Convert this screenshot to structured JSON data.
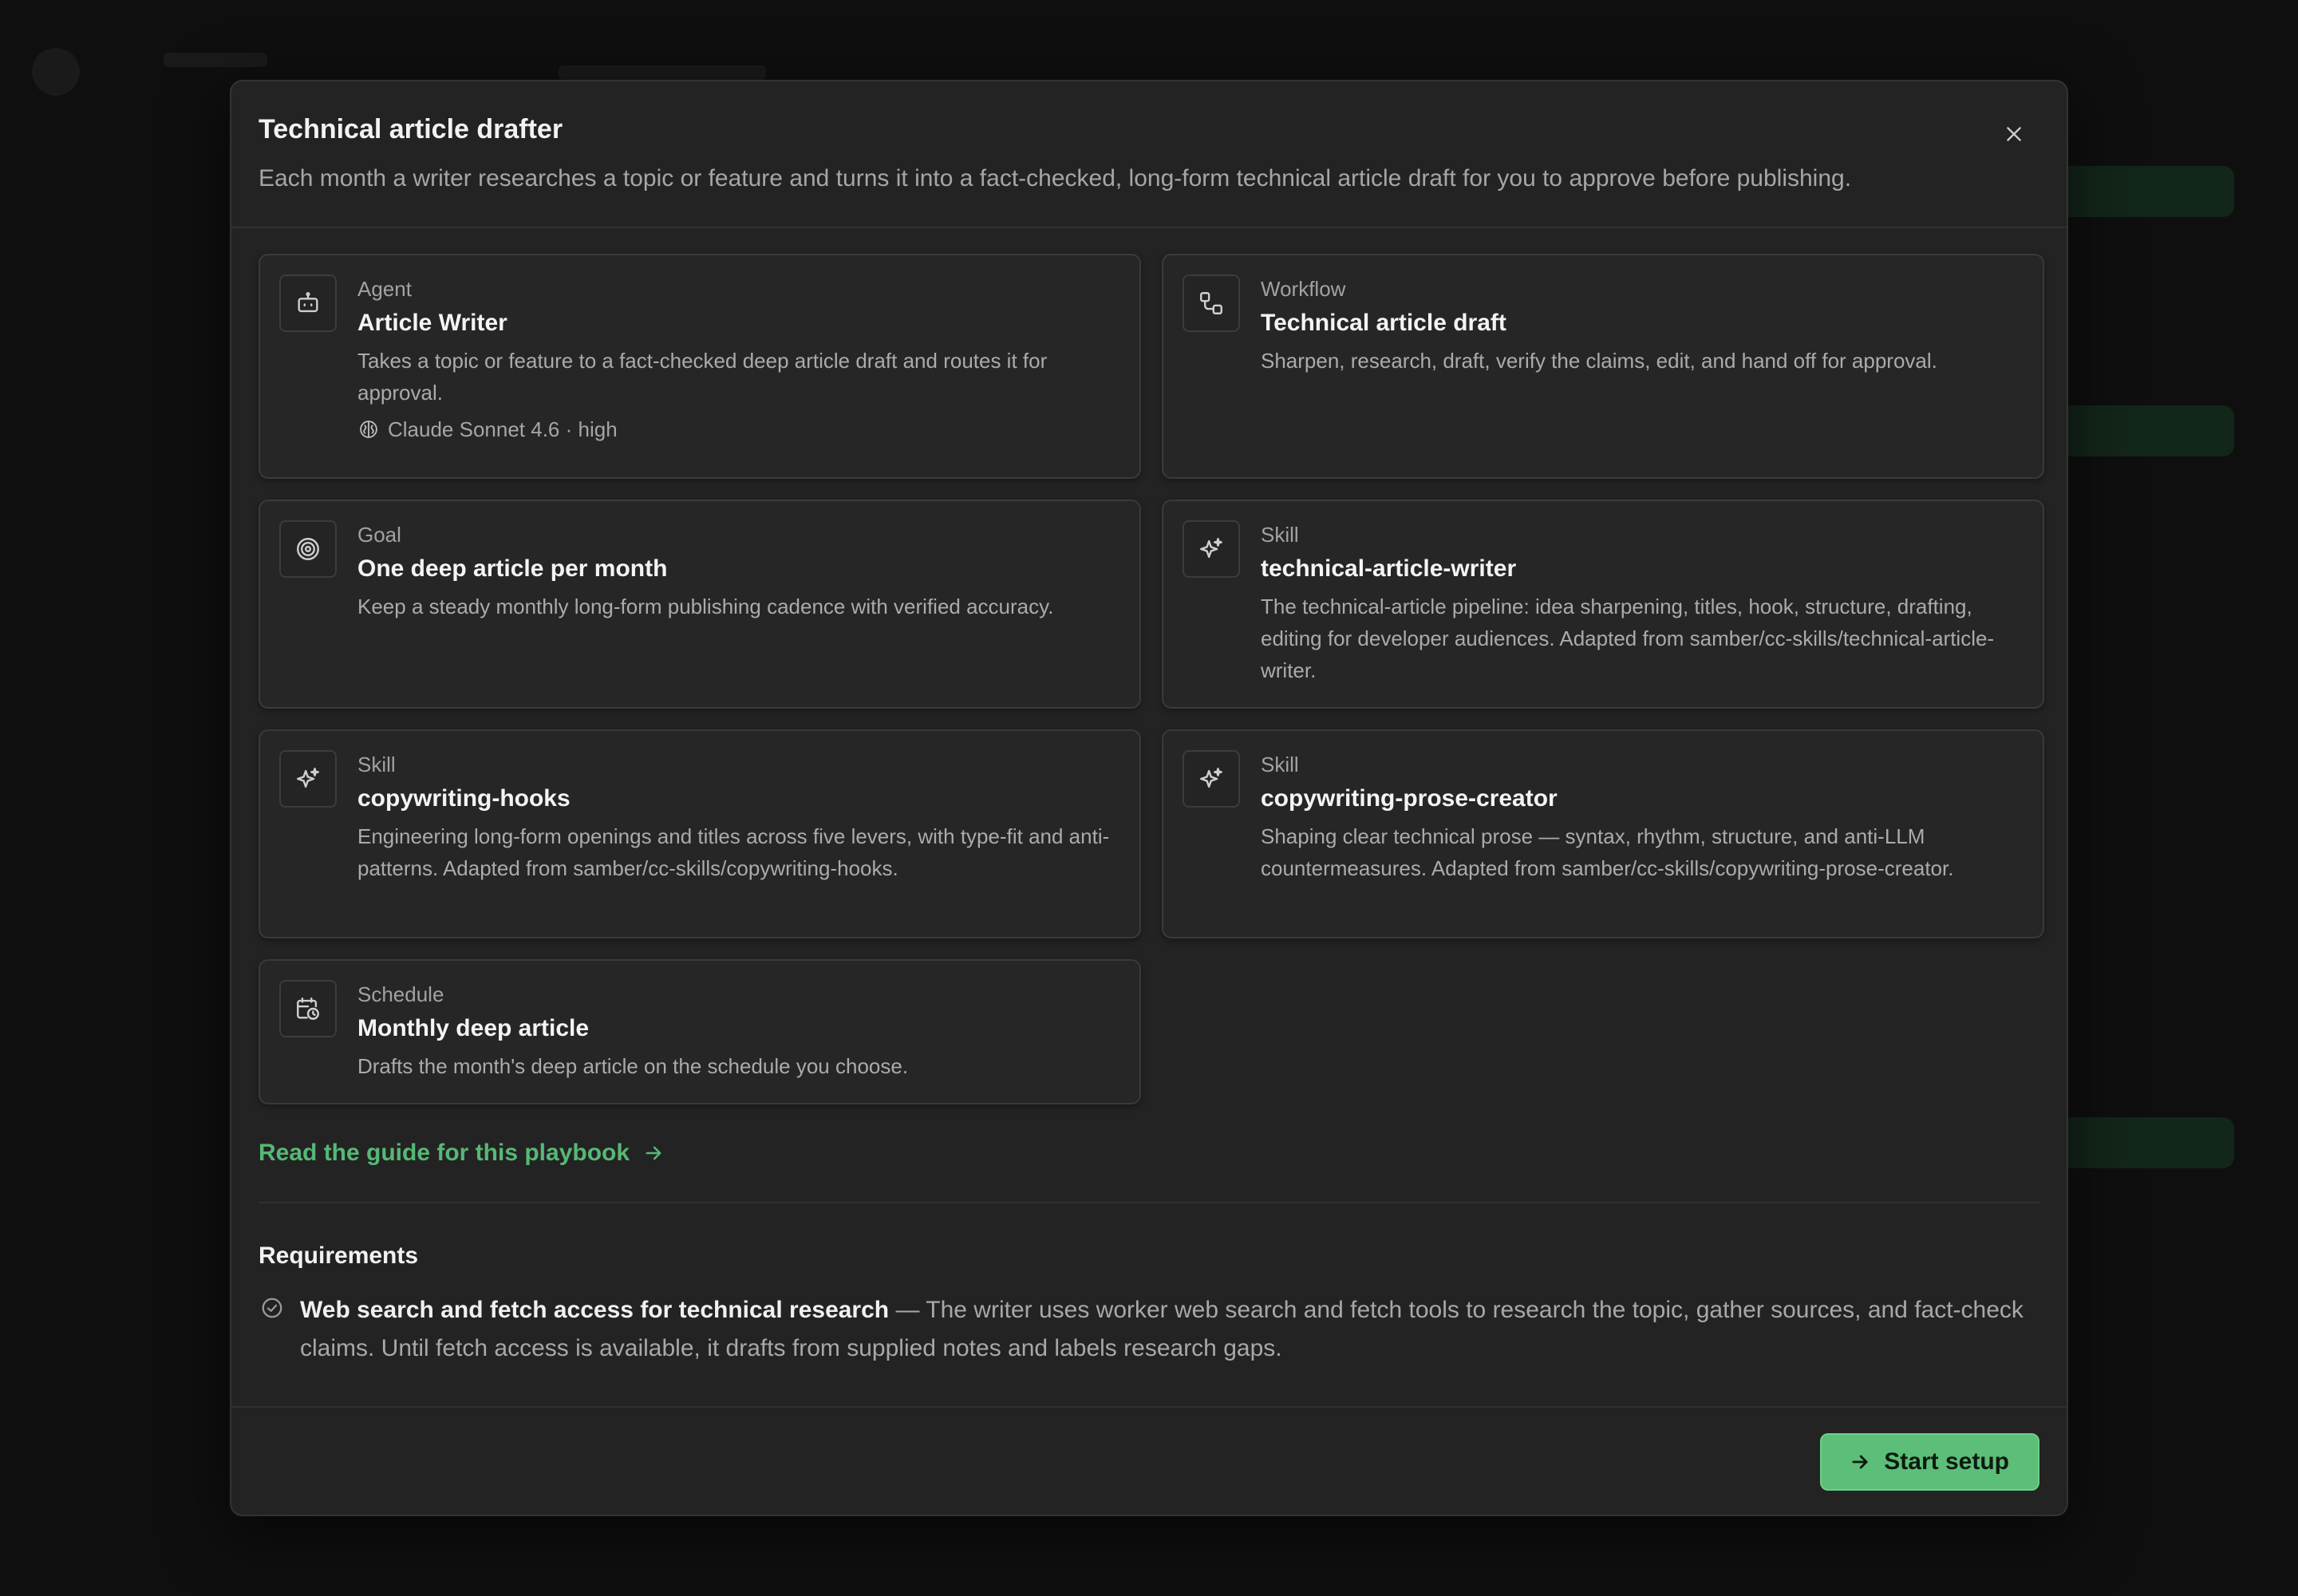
{
  "modal": {
    "title": "Technical article drafter",
    "description": "Each month a writer researches a topic or feature and turns it into a fact-checked, long-form technical article draft for you to approve before publishing.",
    "close_icon": "close-icon"
  },
  "cards": [
    {
      "kind": "Agent",
      "title": "Article Writer",
      "description": "Takes a topic or feature to a fact-checked deep article draft and routes it for approval.",
      "meta": "Claude Sonnet 4.6 · high",
      "icon": "robot-icon"
    },
    {
      "kind": "Workflow",
      "title": "Technical article draft",
      "description": "Sharpen, research, draft, verify the claims, edit, and hand off for approval.",
      "icon": "workflow-icon"
    },
    {
      "kind": "Goal",
      "title": "One deep article per month",
      "description": "Keep a steady monthly long-form publishing cadence with verified accuracy.",
      "icon": "target-icon"
    },
    {
      "kind": "Skill",
      "title": "technical-article-writer",
      "description": "The technical-article pipeline: idea sharpening, titles, hook, structure, drafting, editing for developer audiences. Adapted from samber/cc-skills/technical-article-writer.",
      "icon": "sparkle-icon"
    },
    {
      "kind": "Skill",
      "title": "copywriting-hooks",
      "description": "Engineering long-form openings and titles across five levers, with type-fit and anti-patterns. Adapted from samber/cc-skills/copywriting-hooks.",
      "icon": "sparkle-icon"
    },
    {
      "kind": "Skill",
      "title": "copywriting-prose-creator",
      "description": "Shaping clear technical prose — syntax, rhythm, structure, and anti-LLM countermeasures. Adapted from samber/cc-skills/copywriting-prose-creator.",
      "icon": "sparkle-icon"
    },
    {
      "kind": "Schedule",
      "title": "Monthly deep article",
      "description": "Drafts the month's deep article on the schedule you choose.",
      "icon": "calendar-clock-icon"
    }
  ],
  "guide": {
    "label": "Read the guide for this playbook",
    "icon": "arrow-right-icon"
  },
  "requirements": {
    "title": "Requirements",
    "items": [
      {
        "name": "Web search and fetch access for technical research",
        "description": " — The writer uses worker web search and fetch tools to research the topic, gather sources, and fact-check claims. Until fetch access is available, it drafts from supplied notes and labels research gaps.",
        "icon": "check-circle-icon"
      }
    ]
  },
  "footer": {
    "start_label": "Start setup",
    "start_icon": "arrow-right-icon"
  },
  "colors": {
    "accent": "#5cbe78",
    "link": "#56b875",
    "surface": "#232323",
    "card": "#262626"
  }
}
